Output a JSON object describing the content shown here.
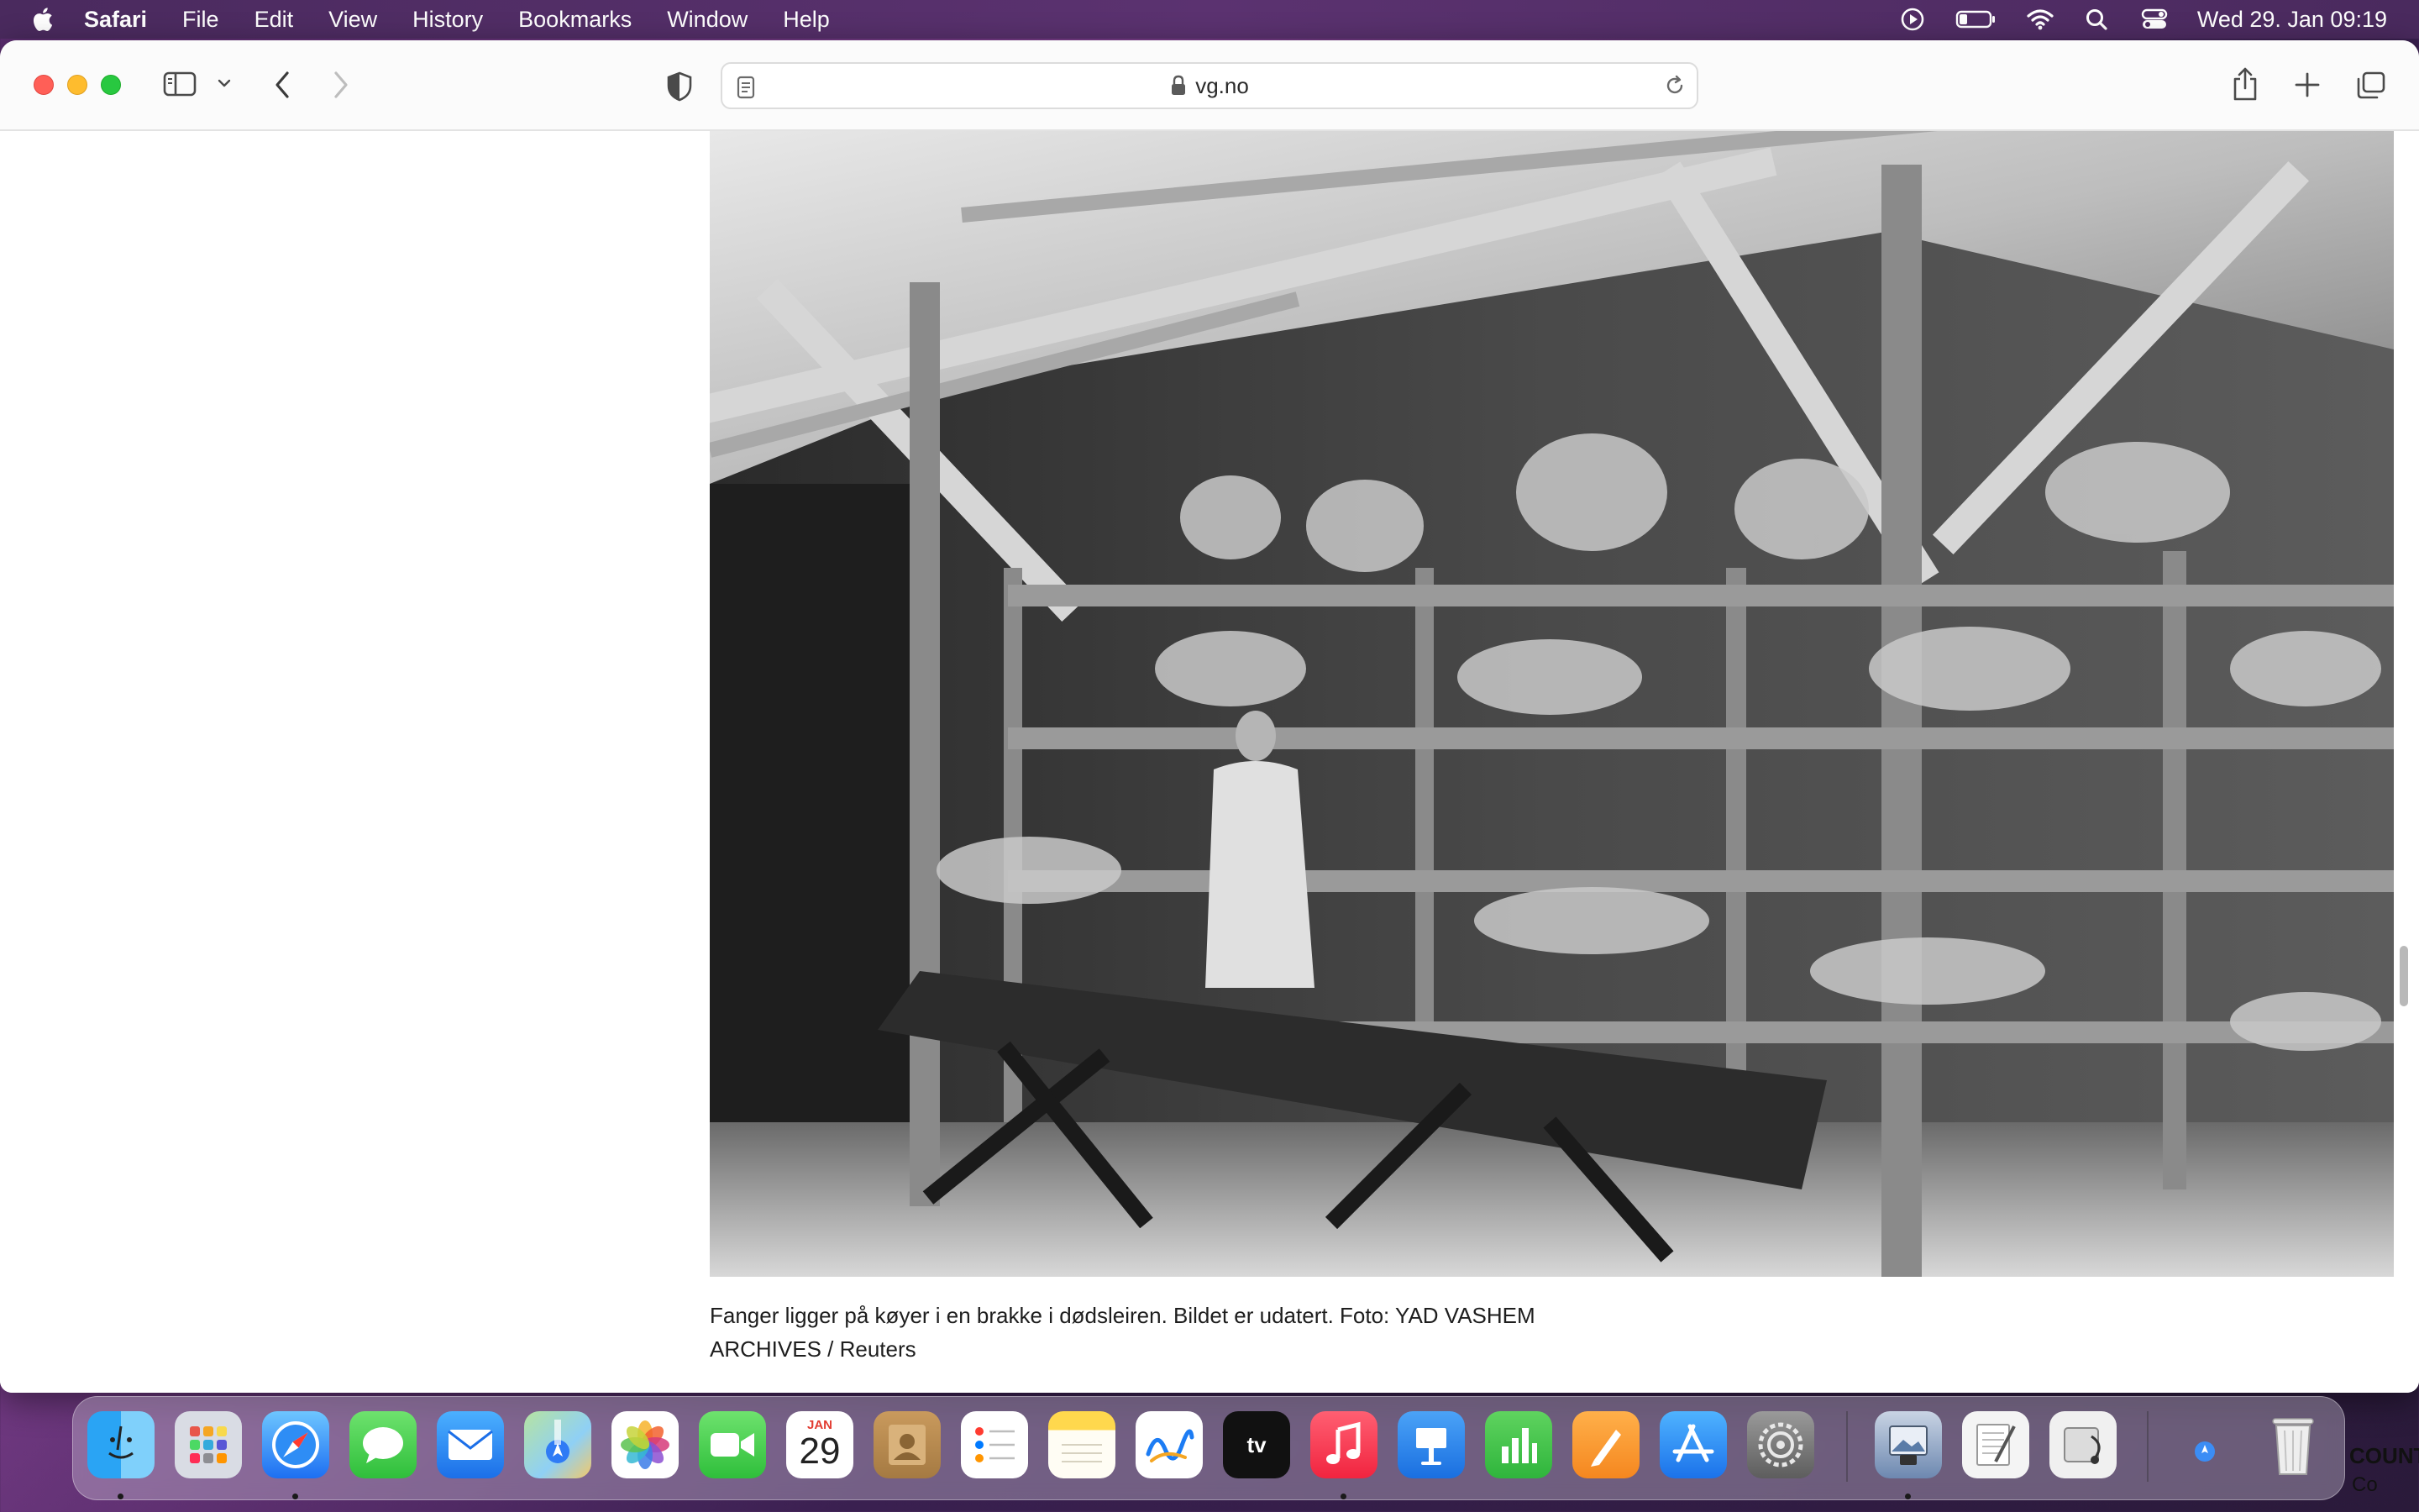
{
  "menubar": {
    "app_name": "Safari",
    "items": [
      "File",
      "Edit",
      "View",
      "History",
      "Bookmarks",
      "Window",
      "Help"
    ],
    "clock": "Wed 29. Jan  09:19"
  },
  "toolbar": {
    "url": "vg.no"
  },
  "article": {
    "caption_line1": "Fanger ligger på køyer i en brakke i dødsleiren. Bildet er udatert. Foto: YAD VASHEM",
    "caption_line2": "ARCHIVES / Reuters"
  },
  "dock": {
    "calendar_month": "JAN",
    "calendar_day": "29",
    "tv_label": "tv"
  },
  "desktop": {
    "snippet1": "COUNT",
    "snippet2": "Co"
  },
  "colors": {
    "traffic_close": "#ff5f57",
    "traffic_minimize": "#febc2e",
    "traffic_maximize": "#28c840",
    "menubar_bg": "#4a2a5e"
  }
}
